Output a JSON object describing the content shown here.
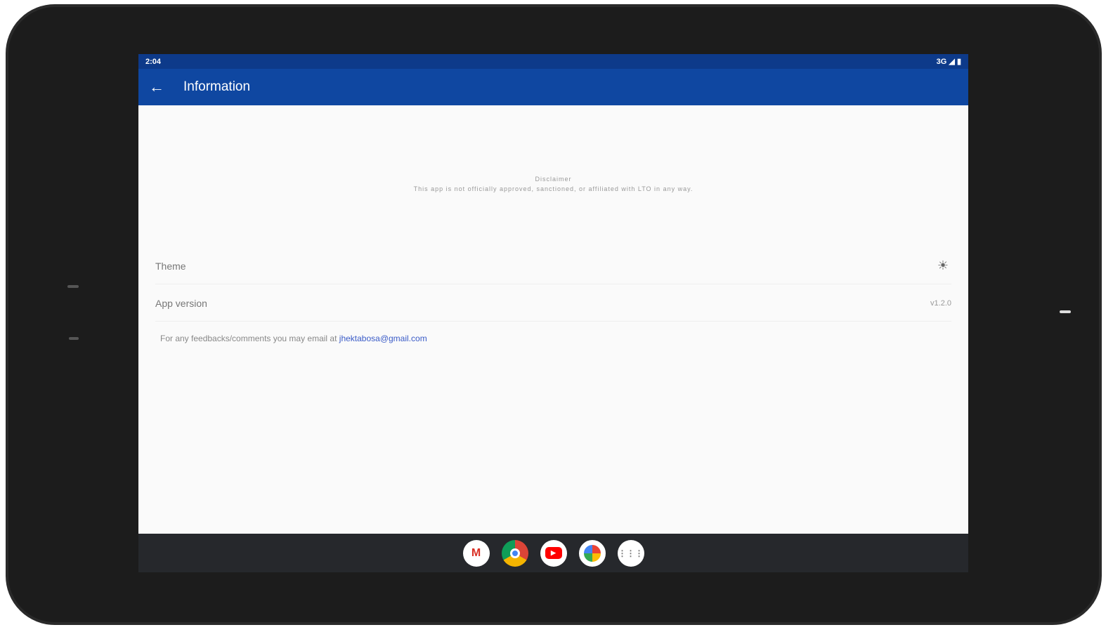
{
  "status": {
    "time": "2:04",
    "network": "3G"
  },
  "appbar": {
    "title": "Information"
  },
  "disclaimer": {
    "heading": "Disclaimer",
    "text": "This app is not officially approved, sanctioned, or affiliated with LTO in any way."
  },
  "settings": [
    {
      "label": "Theme",
      "icon": "sun-icon"
    },
    {
      "label": "App version",
      "value": "v1.2.0"
    }
  ],
  "feedback": {
    "text": "For any feedbacks/comments you may email at ",
    "email": "jhektabosa@gmail.com"
  },
  "dock": [
    "gmail",
    "chrome",
    "youtube",
    "photos",
    "app-drawer"
  ]
}
